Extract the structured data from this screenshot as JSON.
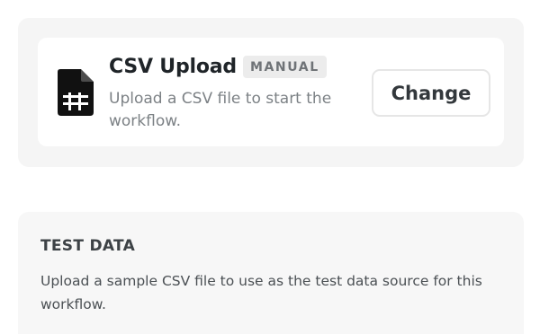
{
  "trigger": {
    "icon": "csv-file-icon",
    "title": "CSV Upload",
    "badge": "MANUAL",
    "description": "Upload a CSV file to start the workflow.",
    "change_label": "Change"
  },
  "test_data": {
    "title": "TEST DATA",
    "description": "Upload a sample CSV file to use as the test data source for this workflow."
  },
  "colors": {
    "panel_bg": "#f5f5f5",
    "card_bg": "#ffffff",
    "badge_bg": "#ececec",
    "icon": "#111111"
  }
}
